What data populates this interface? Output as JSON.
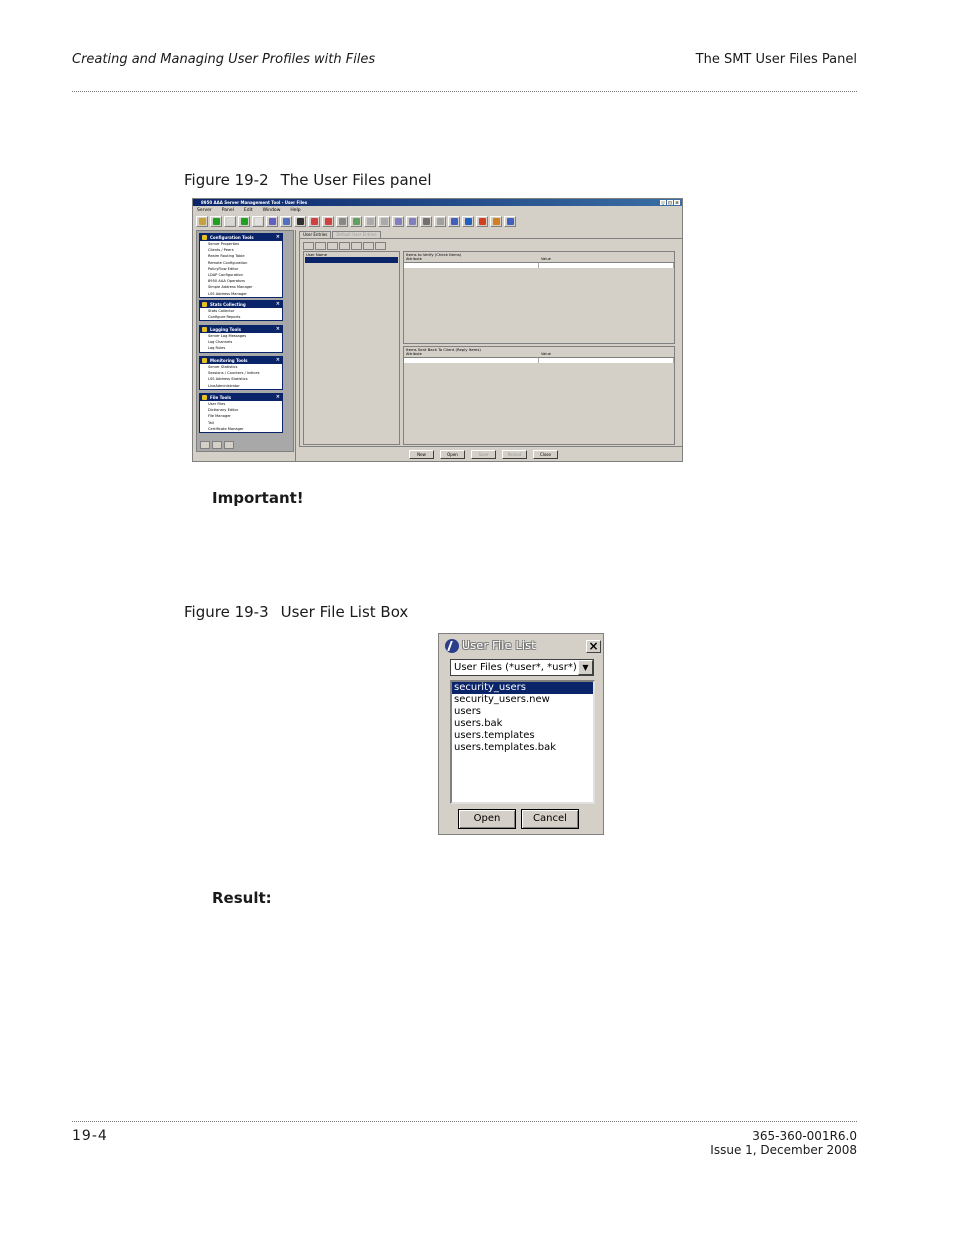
{
  "header": {
    "chapter_title": "Creating and Managing User Profiles with Files",
    "section_title": "The SMT User Files Panel"
  },
  "figure1": {
    "number": "Figure 19-2",
    "caption": "The User Files panel",
    "window_title": "8950 AAA Server Management Tool - User Files",
    "menu": [
      "Server",
      "Panel",
      "Edit",
      "Window",
      "Help"
    ],
    "groups": [
      {
        "title": "Configuration Tools",
        "items": [
          "Server Properties",
          "Clients / Peers",
          "Realm Routing Table",
          "Remote Configuration",
          "PolicyFlow Editor",
          "LDAP Configuration",
          "8950 AAA Operators",
          "Simple Address Manager",
          "LSS Address Manager"
        ]
      },
      {
        "title": "Stats Collecting",
        "items": [
          "Stats Collector",
          "Configure Reports"
        ]
      },
      {
        "title": "Logging Tools",
        "items": [
          "Server Log Messages",
          "Log Channels",
          "Log Rules"
        ]
      },
      {
        "title": "Monitoring Tools",
        "items": [
          "Server Statistics",
          "Sessions / Counters / Indices",
          "LSS Address Statistics",
          "LiveAdministrator"
        ]
      },
      {
        "title": "File Tools",
        "items": [
          "User Files",
          "Dictionary Editor",
          "File Manager",
          "Tail",
          "Certificate Manager"
        ]
      }
    ],
    "tabs": [
      "User Entries",
      "Default User Entries"
    ],
    "user_name_header": "User Name",
    "check_items_caption": "Items to Verify (Check Items)",
    "reply_items_caption": "Items Sent Back To Client (Reply Items)",
    "col_attribute": "Attribute",
    "col_value": "Value",
    "buttons": [
      "New",
      "Open",
      "Save",
      "Reload",
      "Close"
    ]
  },
  "important_label": "Important!",
  "figure2": {
    "number": "Figure 19-3",
    "caption": "User File List Box",
    "dialog_title": "User File List",
    "filter": "User Files (*user*, *usr*)",
    "files": [
      "security_users",
      "security_users.new",
      "users",
      "users.bak",
      "users.templates",
      "users.templates.bak"
    ],
    "selected_index": 0,
    "open_button": "Open",
    "cancel_button": "Cancel"
  },
  "result_label": "Result:",
  "footer": {
    "page_number": "19-4",
    "doc_number": "365-360-001R6.0",
    "issue": "Issue 1, December 2008"
  }
}
